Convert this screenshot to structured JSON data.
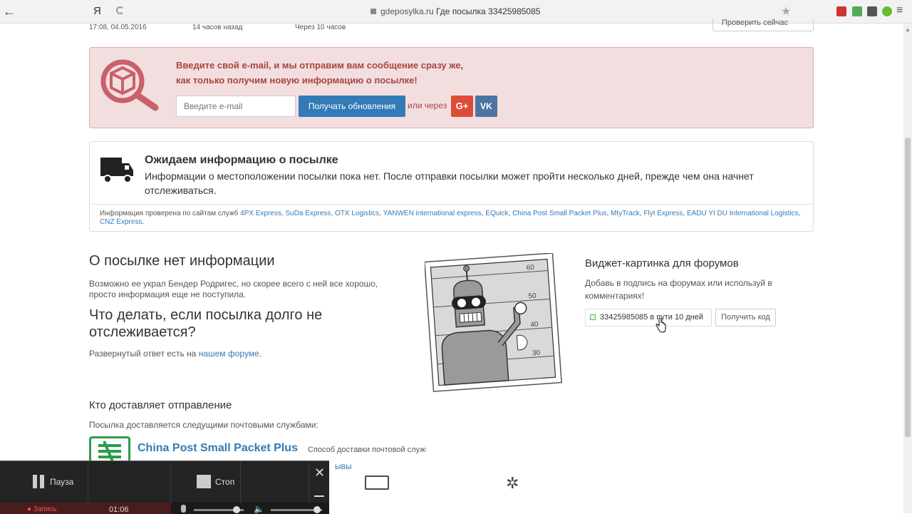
{
  "browser": {
    "back": "←",
    "tab_logo": "Я",
    "url_domain": "gdeposylka.ru",
    "url_title": "Где посылка 33425985085",
    "star": "★",
    "menu": "≡"
  },
  "tracking_row": {
    "datetime": "17:08, 04.05.2016",
    "ago": "14 часов назад",
    "next": "Через 10 часов",
    "check_now": "Проверить сейчас"
  },
  "alert": {
    "line1": "Введите свой e-mail, и мы отправим вам сообщение сразу же,",
    "line2": "как только получим новую информацию о посылке!",
    "email_placeholder": "Введите e-mail",
    "subscribe_label": "Получать обновления",
    "or_label": "или через",
    "gplus_label": "G+",
    "vk_label": "VK"
  },
  "status": {
    "title": "Ожидаем информацию о посылке",
    "description": "Информации о местоположении посылки пока нет. После отправки посылки может пройти несколько дней, прежде чем она начнет отслеживаться.",
    "services_prefix": "Информация проверена по сайтам служб",
    "services": [
      "4PX Express",
      "SuDa Express",
      "OTX Logistics",
      "YANWEN international express",
      "EQuick",
      "China Post Small Packet Plus",
      "MtyTrack",
      "Flyt Express",
      "EADU YI DU International Logistics",
      "CNZ Express"
    ]
  },
  "info": {
    "no_info_title": "О посылке нет информации",
    "no_info_text": "Возможно ее украл Бендер Родригес, но скорее всего с ней все хорошо, просто информация еще не поступила.",
    "what_todo_title": "Что делать, если посылка долго не отслеживается?",
    "forum_prefix": "Развернутый ответ есть на",
    "forum_link": "нашем форуме",
    "forum_suffix": "."
  },
  "bender": {
    "marks": [
      "60",
      "50",
      "40",
      "30"
    ]
  },
  "widget": {
    "title": "Виджет-картинка для форумов",
    "description": "Добавь в подпись на форумах или используй в комментариях!",
    "preview_text": "33425985085 в пути 10 дней",
    "get_code_label": "Получить код"
  },
  "carrier": {
    "title": "Кто доставляет отправление",
    "description": "Посылка доставляется следущими почтовыми службами:",
    "name": "China Post Small Packet Plus",
    "note": "Способ доставки почтовой службы",
    "link_fragment": "ывы"
  },
  "recorder": {
    "pause_label": "Пауза",
    "stop_label": "Стоп",
    "close": "✕",
    "rec_label": "● Запись",
    "rec_time": "01:06",
    "mic_level": 0.85,
    "speaker_level": 0.9
  },
  "colors": {
    "accent": "#337ab7",
    "alert_bg": "#f2dede",
    "alert_text": "#a94442",
    "gplus": "#dd4b39",
    "vk": "#4c75a3",
    "china_post": "#2a9d4a"
  }
}
